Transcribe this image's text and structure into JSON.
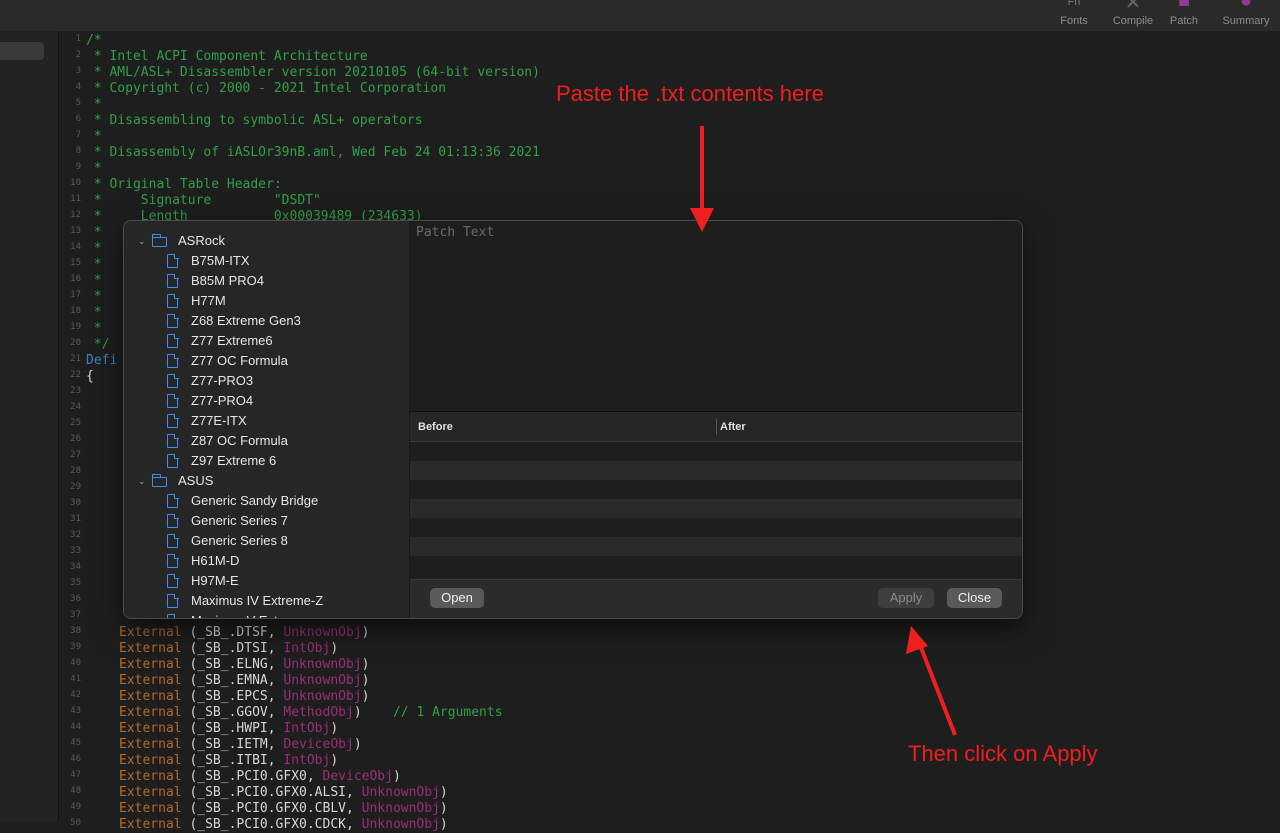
{
  "toolbar": {
    "items": [
      {
        "label": "Fonts",
        "icon": "font-icon"
      },
      {
        "label": "Compile",
        "icon": "compile-icon"
      },
      {
        "label": "Patch",
        "icon": "patch-icon"
      },
      {
        "label": "Summary",
        "icon": "info-icon"
      }
    ],
    "top_hint": "Fn"
  },
  "editor": {
    "lines": [
      {
        "n": "1",
        "text": "/*",
        "cls": "c-com"
      },
      {
        "n": "2",
        "text": " * Intel ACPI Component Architecture",
        "cls": "c-com"
      },
      {
        "n": "3",
        "text": " * AML/ASL+ Disassembler version 20210105 (64-bit version)",
        "cls": "c-com"
      },
      {
        "n": "4",
        "text": " * Copyright (c) 2000 - 2021 Intel Corporation",
        "cls": "c-com"
      },
      {
        "n": "5",
        "text": " *",
        "cls": "c-com"
      },
      {
        "n": "6",
        "text": " * Disassembling to symbolic ASL+ operators",
        "cls": "c-com"
      },
      {
        "n": "7",
        "text": " *",
        "cls": "c-com"
      },
      {
        "n": "8",
        "text": " * Disassembly of iASLOr39nB.aml, Wed Feb 24 01:13:36 2021",
        "cls": "c-com"
      },
      {
        "n": "9",
        "text": " *",
        "cls": "c-com"
      },
      {
        "n": "10",
        "text": " * Original Table Header:",
        "cls": "c-com"
      },
      {
        "n": "11",
        "text": " *     Signature        \"DSDT\"",
        "cls": "c-com"
      },
      {
        "n": "12",
        "text": " *     Length           0x00039489 (234633)",
        "cls": "c-com"
      },
      {
        "n": "13",
        "text": " *",
        "cls": "c-com"
      },
      {
        "n": "14",
        "text": " *",
        "cls": "c-com"
      },
      {
        "n": "15",
        "text": " *",
        "cls": "c-com"
      },
      {
        "n": "16",
        "text": " *",
        "cls": "c-com"
      },
      {
        "n": "17",
        "text": " *",
        "cls": "c-com"
      },
      {
        "n": "18",
        "text": " *",
        "cls": "c-com"
      },
      {
        "n": "19",
        "text": " *",
        "cls": "c-com"
      },
      {
        "n": "20",
        "text": " */",
        "cls": "c-com"
      },
      {
        "n": "21",
        "text": "Defi",
        "cls": "c-blue"
      },
      {
        "n": "22",
        "text": "{",
        "cls": "c-def"
      }
    ],
    "gutter_more": [
      "23",
      "24",
      "25",
      "26",
      "27",
      "28",
      "29",
      "30",
      "31",
      "32",
      "33",
      "34",
      "35",
      "36",
      "37"
    ],
    "ext_lines": [
      {
        "n": "38",
        "path": "(_SB_.DTSF, ",
        "obj": "UnknownObj",
        "tail": ")"
      },
      {
        "n": "39",
        "path": "(_SB_.DTSI, ",
        "obj": "IntObj",
        "tail": ")"
      },
      {
        "n": "40",
        "path": "(_SB_.ELNG, ",
        "obj": "UnknownObj",
        "tail": ")"
      },
      {
        "n": "41",
        "path": "(_SB_.EMNA, ",
        "obj": "UnknownObj",
        "tail": ")"
      },
      {
        "n": "42",
        "path": "(_SB_.EPCS, ",
        "obj": "UnknownObj",
        "tail": ")"
      },
      {
        "n": "43",
        "path": "(_SB_.GGOV, ",
        "obj": "MethodObj",
        "tail": ")    ",
        "comment": "// 1 Arguments"
      },
      {
        "n": "44",
        "path": "(_SB_.HWPI, ",
        "obj": "IntObj",
        "tail": ")"
      },
      {
        "n": "45",
        "path": "(_SB_.IETM, ",
        "obj": "DeviceObj",
        "tail": ")"
      },
      {
        "n": "46",
        "path": "(_SB_.ITBI, ",
        "obj": "IntObj",
        "tail": ")"
      },
      {
        "n": "47",
        "path": "(_SB_.PCI0.GFX0, ",
        "obj": "DeviceObj",
        "tail": ")"
      },
      {
        "n": "48",
        "path": "(_SB_.PCI0.GFX0.ALSI, ",
        "obj": "UnknownObj",
        "tail": ")"
      },
      {
        "n": "49",
        "path": "(_SB_.PCI0.GFX0.CBLV, ",
        "obj": "UnknownObj",
        "tail": ")"
      },
      {
        "n": "50",
        "path": "(_SB_.PCI0.GFX0.CDCK, ",
        "obj": "UnknownObj",
        "tail": ")"
      }
    ],
    "ext_keyword": "External "
  },
  "dialog": {
    "tree": [
      {
        "type": "folder",
        "label": "ASRock"
      },
      {
        "type": "file",
        "label": "B75M-ITX"
      },
      {
        "type": "file",
        "label": "B85M PRO4"
      },
      {
        "type": "file",
        "label": "H77M"
      },
      {
        "type": "file",
        "label": "Z68 Extreme Gen3"
      },
      {
        "type": "file",
        "label": "Z77 Extreme6"
      },
      {
        "type": "file",
        "label": "Z77 OC Formula"
      },
      {
        "type": "file",
        "label": "Z77-PRO3"
      },
      {
        "type": "file",
        "label": "Z77-PRO4"
      },
      {
        "type": "file",
        "label": "Z77E-ITX"
      },
      {
        "type": "file",
        "label": "Z87 OC Formula"
      },
      {
        "type": "file",
        "label": "Z97 Extreme 6"
      },
      {
        "type": "folder",
        "label": "ASUS"
      },
      {
        "type": "file",
        "label": "Generic Sandy Bridge"
      },
      {
        "type": "file",
        "label": "Generic Series 7"
      },
      {
        "type": "file",
        "label": "Generic Series 8"
      },
      {
        "type": "file",
        "label": "H61M-D"
      },
      {
        "type": "file",
        "label": "H97M-E"
      },
      {
        "type": "file",
        "label": "Maximus IV Extreme-Z"
      },
      {
        "type": "file",
        "label": "Maximus V Extreme"
      }
    ],
    "patch_placeholder": "Patch Text",
    "columns": {
      "before": "Before",
      "after": "After"
    },
    "buttons": {
      "open": "Open",
      "apply": "Apply",
      "close": "Close"
    }
  },
  "annotations": {
    "top": "Paste the .txt contents here",
    "bottom": "Then click on Apply",
    "color": "#f01f1f"
  }
}
